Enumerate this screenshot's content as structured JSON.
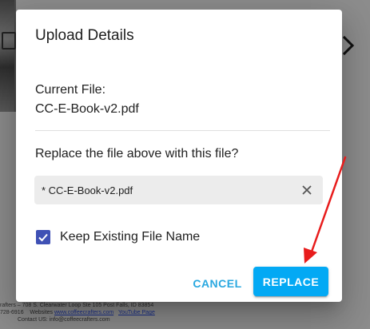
{
  "background": {
    "next_icon": "chevron-right-icon",
    "footer": {
      "address": "rafters – 708 S. Clearwater Loop Ste 105 Post Falls, ID 83854",
      "phone": "728-6916",
      "websites_label": "Websites",
      "website_link": "www.coffeecrafters.com",
      "youtube_link": "YouTube Page",
      "contact": "Contact US: info@coffeecrafters.com"
    }
  },
  "dialog": {
    "title": "Upload Details",
    "current_file_label": "Current File:",
    "current_file_name": "CC-E-Book-v2.pdf",
    "replace_question": "Replace the file above with this file?",
    "new_file_name": "* CC-E-Book-v2.pdf",
    "clear_icon": "close-icon",
    "keep_name": {
      "label": "Keep Existing File Name",
      "checked": true
    },
    "cancel_label": "CANCEL",
    "replace_label": "REPLACE"
  },
  "colors": {
    "accent": "#03a9f4",
    "cancel_text": "#29a8e0",
    "checkbox": "#3f51b5",
    "annotation_arrow": "#e81c1c"
  }
}
